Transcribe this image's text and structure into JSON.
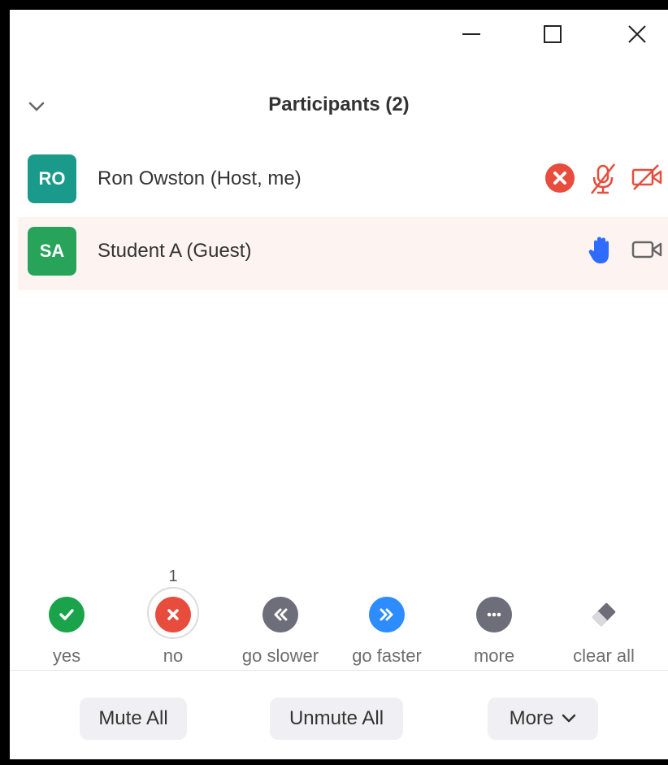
{
  "header": {
    "title": "Participants (2)"
  },
  "participants": [
    {
      "initials": "RO",
      "name": "Ron Owston (Host, me)",
      "avatar_color": "#1a9a8a",
      "icons": [
        "remove-x-icon",
        "mic-muted-icon",
        "video-off-icon"
      ]
    },
    {
      "initials": "SA",
      "name": "Student A (Guest)",
      "avatar_color": "#27a35a",
      "icons": [
        "raised-hand-icon",
        "video-camera-icon"
      ]
    }
  ],
  "reactions": [
    {
      "label": "yes",
      "count": "",
      "icon": "check-icon",
      "color": "#1aa34a"
    },
    {
      "label": "no",
      "count": "1",
      "icon": "x-icon",
      "color": "#e84c3d"
    },
    {
      "label": "go slower",
      "count": "",
      "icon": "rewind-icon",
      "color": "#6d6e7a"
    },
    {
      "label": "go faster",
      "count": "",
      "icon": "fast-forward-icon",
      "color": "#2d8cff"
    },
    {
      "label": "more",
      "count": "",
      "icon": "ellipsis-icon",
      "color": "#6d6e7a"
    },
    {
      "label": "clear all",
      "count": "",
      "icon": "eraser-icon",
      "color": "#8a8a8a"
    }
  ],
  "footer": {
    "mute_all": "Mute All",
    "unmute_all": "Unmute All",
    "more": "More"
  },
  "colors": {
    "row_highlight": "#fdf3f0",
    "danger": "#e84c3d",
    "accent_blue": "#2d6cff"
  }
}
